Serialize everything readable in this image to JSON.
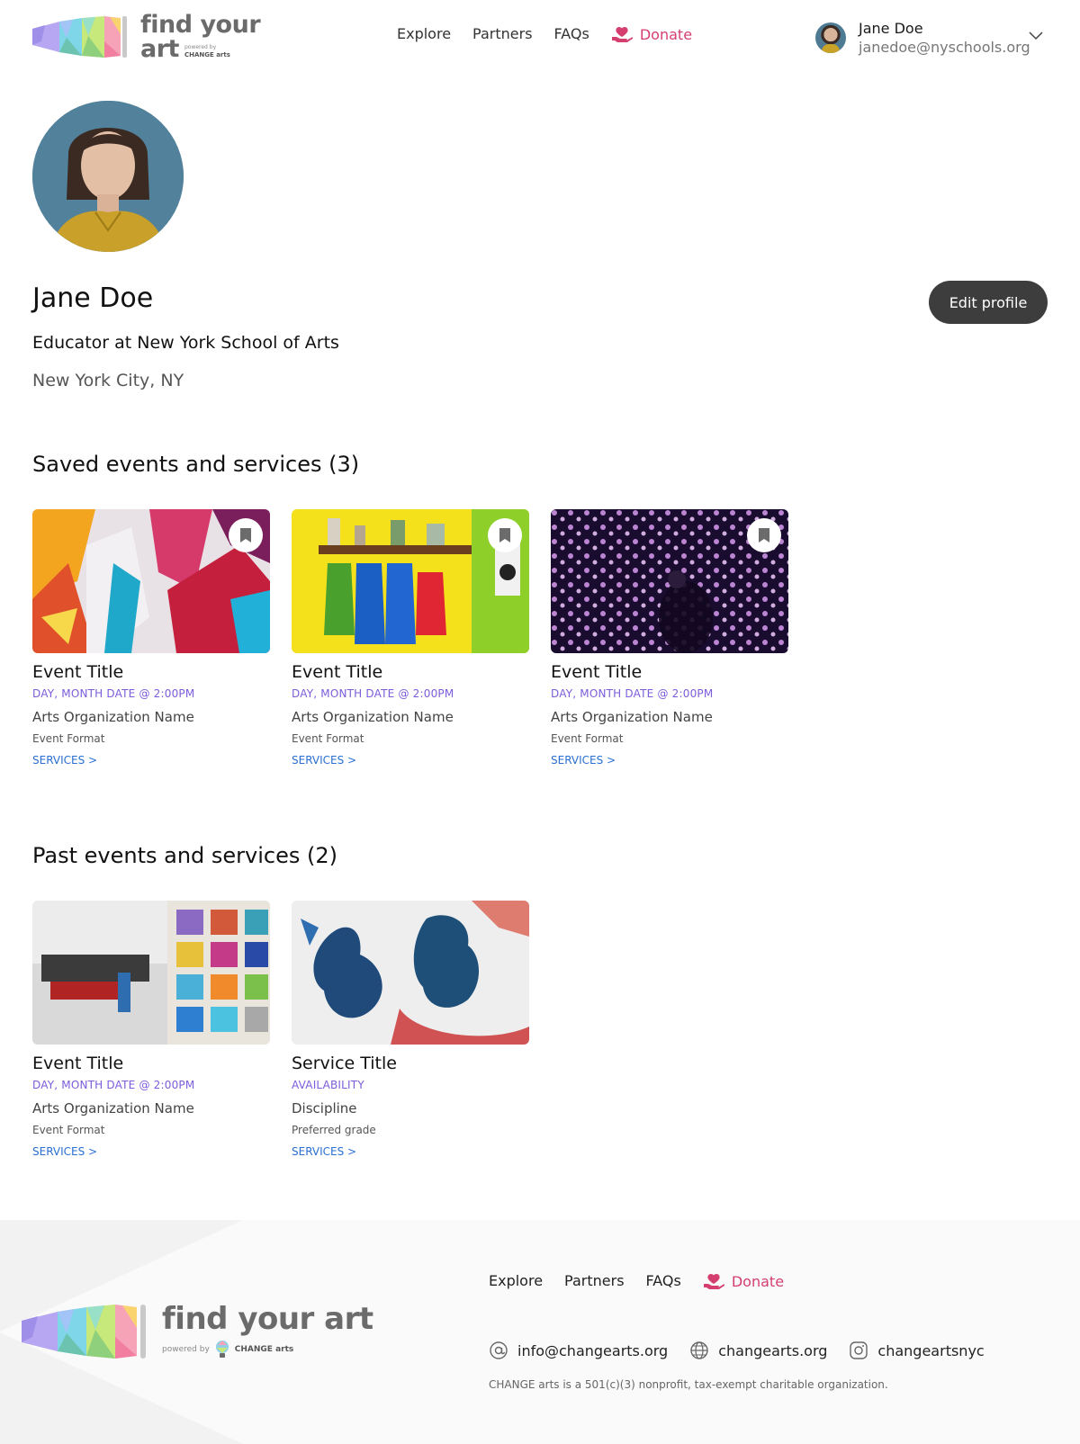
{
  "header": {
    "logo": {
      "line1": "find your",
      "line2": "art",
      "powered_by": "powered by",
      "brand": "CHANGE arts"
    },
    "nav": [
      {
        "label": "Explore"
      },
      {
        "label": "Partners"
      },
      {
        "label": "FAQs"
      }
    ],
    "donate_label": "Donate",
    "user": {
      "name": "Jane Doe",
      "email": "janedoe@nyschools.org"
    }
  },
  "profile": {
    "name": "Jane Doe",
    "role": "Educator at New York School of Arts",
    "location": "New York City, NY",
    "edit_label": "Edit profile"
  },
  "saved": {
    "title": "Saved events and services (3)",
    "cards": [
      {
        "title": "Event Title",
        "date": "DAY, MONTH DATE @ 2:00PM",
        "org": "Arts Organization Name",
        "format": "Event Format",
        "services": "SERVICES >"
      },
      {
        "title": "Event Title",
        "date": "DAY, MONTH DATE @ 2:00PM",
        "org": "Arts Organization Name",
        "format": "Event Format",
        "services": "SERVICES >"
      },
      {
        "title": "Event Title",
        "date": "DAY, MONTH DATE @ 2:00PM",
        "org": "Arts Organization Name",
        "format": "Event Format",
        "services": "SERVICES >"
      }
    ]
  },
  "past": {
    "title": "Past events and services (2)",
    "cards": [
      {
        "title": "Event Title",
        "date": "DAY, MONTH DATE @ 2:00PM",
        "org": "Arts Organization Name",
        "format": "Event Format",
        "services": "SERVICES >"
      },
      {
        "title": "Service Title",
        "date": "AVAILABILITY",
        "org": "Discipline",
        "format": "Preferred grade",
        "services": "SERVICES >"
      }
    ]
  },
  "footer": {
    "logo": {
      "text": "find your art",
      "powered_by": "powered by",
      "brand": "CHANGE arts"
    },
    "nav": [
      {
        "label": "Explore"
      },
      {
        "label": "Partners"
      },
      {
        "label": "FAQs"
      }
    ],
    "donate_label": "Donate",
    "email": "info@changearts.org",
    "website": "changearts.org",
    "instagram": "changeartsnyc",
    "note": "CHANGE arts is a 501(c)(3) nonprofit, tax-exempt charitable organization."
  },
  "colors": {
    "accent_pink": "#d43f6f",
    "date_purple": "#7c5cdb",
    "link_blue": "#2a6fd1",
    "button_dark": "#3d3d3d"
  }
}
